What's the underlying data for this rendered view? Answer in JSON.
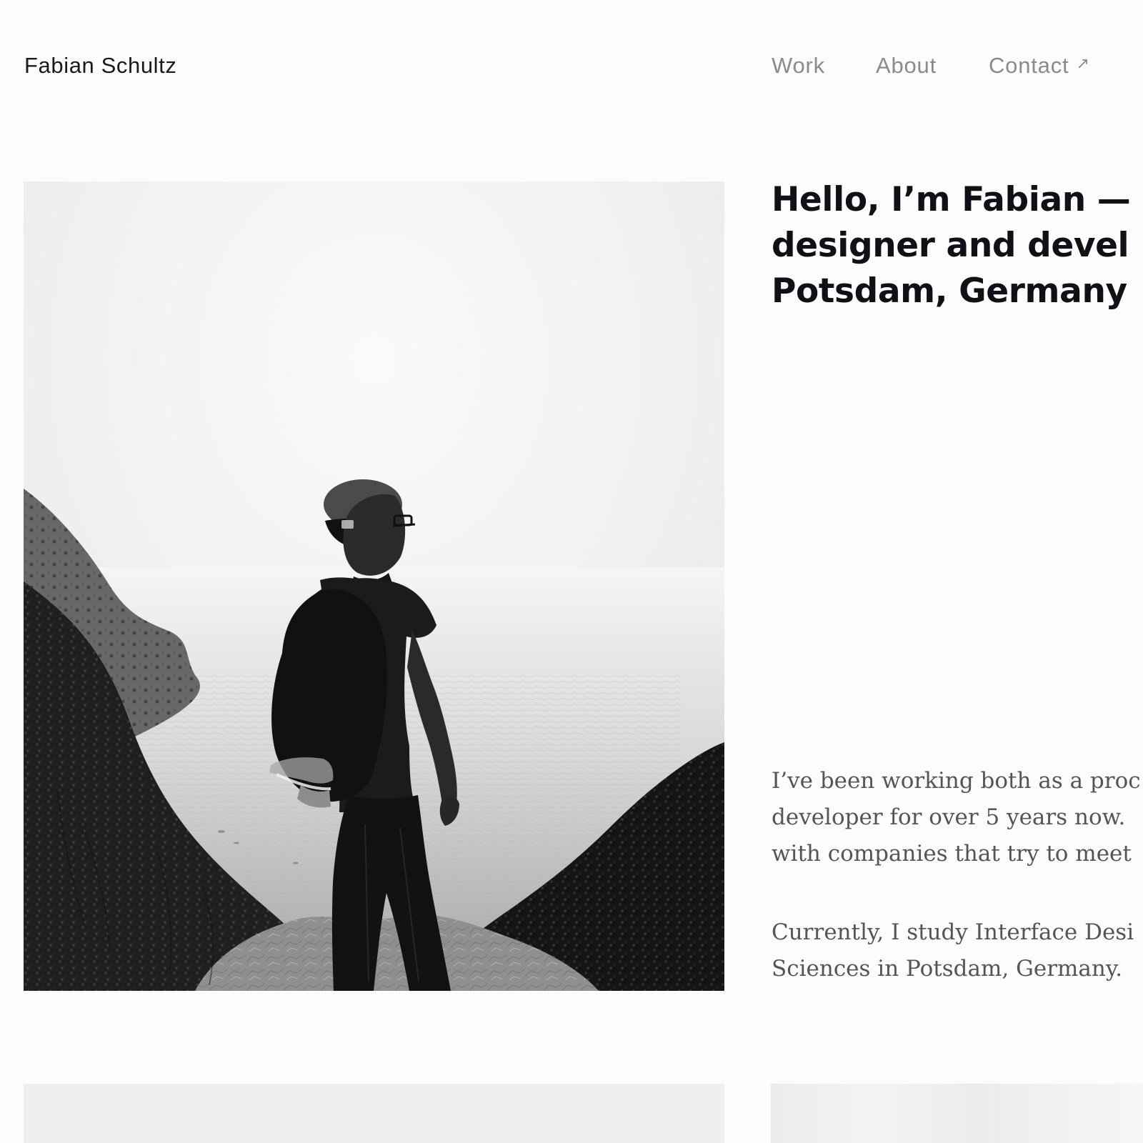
{
  "brand": {
    "name": "Fabian Schultz"
  },
  "nav": {
    "items": [
      {
        "label": "Work"
      },
      {
        "label": "About"
      },
      {
        "label": "Contact",
        "icon": "external-link-arrow-icon"
      }
    ]
  },
  "hero": {
    "headline_lines": [
      "Hello, I’m Fabian —",
      "designer and devel",
      "Potsdam, Germany"
    ],
    "photo_alt": "Black and white photograph of a person with a backpack looking out over the sea from a cliff"
  },
  "bio": {
    "paragraph_1_lines": [
      "I’ve been working both as a proc",
      "developer for over 5 years now.",
      "with companies that try to meet"
    ],
    "paragraph_2_lines": [
      "Currently, I study Interface Desi",
      "Sciences in Potsdam, Germany."
    ]
  },
  "theme": {
    "background": "#fcfcfc",
    "text": "#111111",
    "muted": "#8b8b8b",
    "body_text": "#555555"
  }
}
